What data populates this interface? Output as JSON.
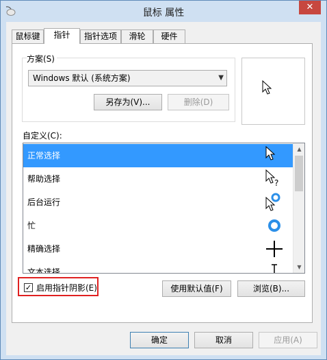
{
  "window": {
    "title": "鼠标 属性",
    "close_symbol": "✕"
  },
  "tabs": [
    {
      "label": "鼠标键",
      "active": false
    },
    {
      "label": "指针",
      "active": true
    },
    {
      "label": "指针选项",
      "active": false
    },
    {
      "label": "滑轮",
      "active": false
    },
    {
      "label": "硬件",
      "active": false
    }
  ],
  "scheme": {
    "group_label": "方案(S)",
    "selected_value": "Windows 默认 (系统方案)",
    "save_as_label": "另存为(V)...",
    "delete_label": "删除(D)"
  },
  "customize": {
    "label": "自定义(C):",
    "rows": [
      {
        "label": "正常选择",
        "icon": "arrow-cursor-icon",
        "selected": true
      },
      {
        "label": "帮助选择",
        "icon": "help-cursor-icon",
        "selected": false
      },
      {
        "label": "后台运行",
        "icon": "working-background-cursor-icon",
        "selected": false
      },
      {
        "label": "忙",
        "icon": "busy-cursor-icon",
        "selected": false
      },
      {
        "label": "精确选择",
        "icon": "crosshair-cursor-icon",
        "selected": false
      },
      {
        "label": "文本选择",
        "icon": "text-cursor-icon",
        "selected": false
      }
    ]
  },
  "shadow": {
    "label": "启用指针阴影(E)",
    "checked": true
  },
  "actions": {
    "use_default_label": "使用默认值(F)",
    "browse_label": "浏览(B)..."
  },
  "dialog": {
    "ok_label": "确定",
    "cancel_label": "取消",
    "apply_label": "应用(A)"
  },
  "colors": {
    "selection": "#3399ff",
    "highlight_box": "#e02020",
    "busy_ring": "#2b8fe8"
  }
}
